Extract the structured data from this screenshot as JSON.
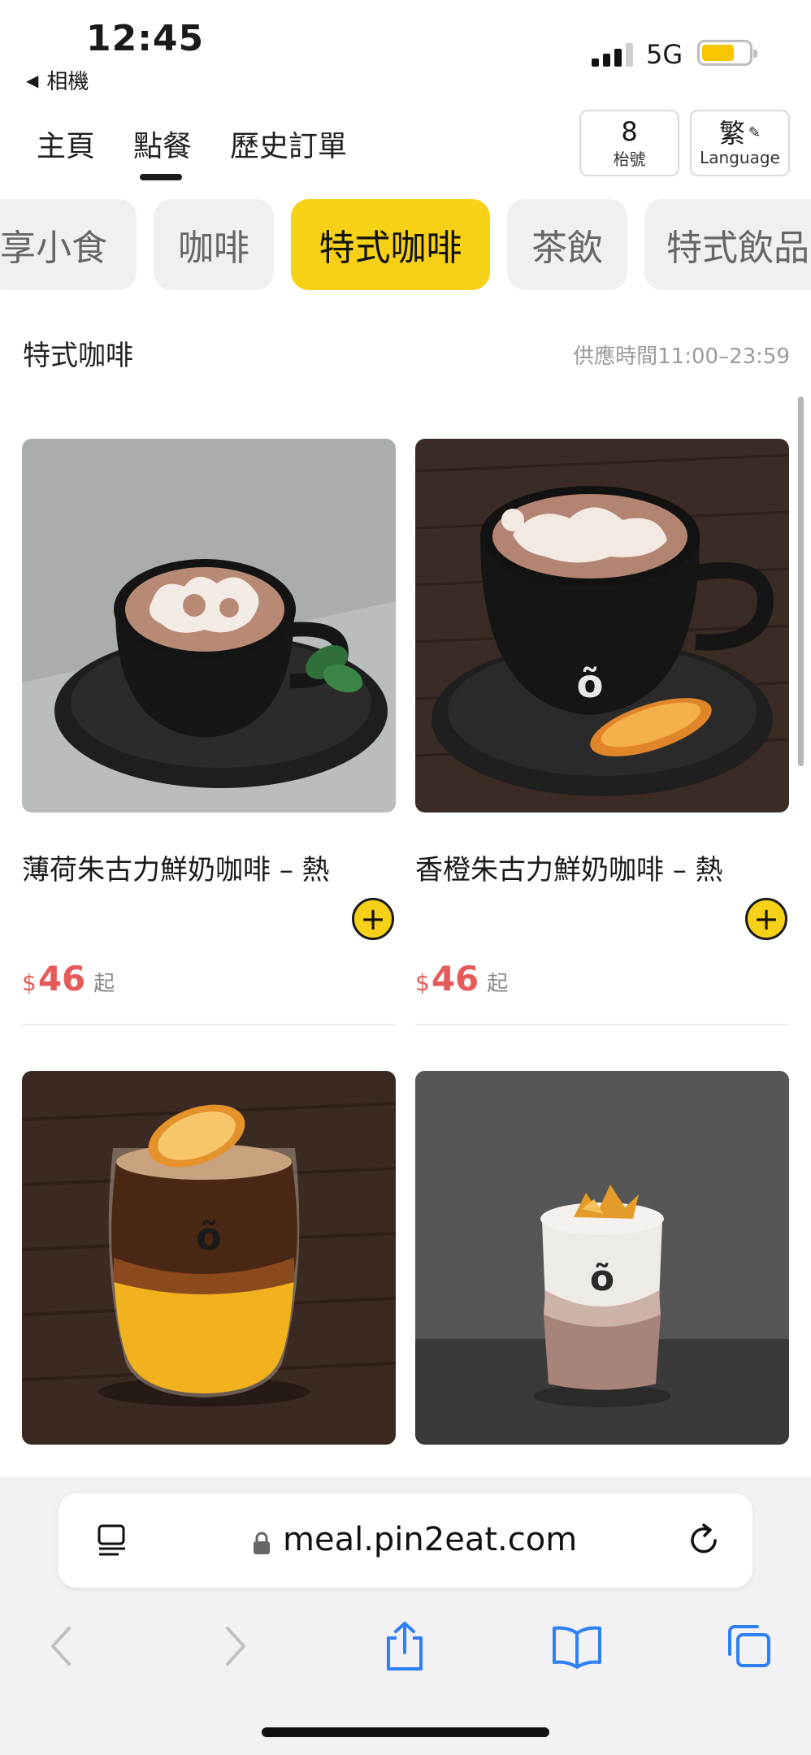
{
  "status_bar": {
    "time": "12:45",
    "back_app": "相機",
    "network": "5G",
    "battery_level": 0.7
  },
  "nav": {
    "tabs": [
      {
        "label": "主頁",
        "active": false
      },
      {
        "label": "點餐",
        "active": true
      },
      {
        "label": "歷史訂單",
        "active": false
      }
    ],
    "table_number": "8",
    "table_label": "枱號",
    "language_current": "繁",
    "language_label": "Language"
  },
  "categories": [
    {
      "label": "享小食",
      "active": false
    },
    {
      "label": "咖啡",
      "active": false
    },
    {
      "label": "特式咖啡",
      "active": true
    },
    {
      "label": "茶飲",
      "active": false
    },
    {
      "label": "特式飲品",
      "active": false
    }
  ],
  "section": {
    "title": "特式咖啡",
    "serve_time": "供應時間11:00–23:59"
  },
  "products": [
    {
      "name": "薄荷朱古力鮮奶咖啡 – 熱",
      "currency": "$",
      "price": "46",
      "suffix": "起",
      "image": "mint-chocolate-latte-photo"
    },
    {
      "name": "香橙朱古力鮮奶咖啡 – 熱",
      "currency": "$",
      "price": "46",
      "suffix": "起",
      "image": "orange-chocolate-latte-photo"
    },
    {
      "name": "",
      "image": "orange-iced-coffee-photo"
    },
    {
      "name": "",
      "image": "iced-latte-crumble-photo"
    }
  ],
  "browser": {
    "url": "meal.pin2eat.com"
  },
  "colors": {
    "accent_yellow": "#f7d117",
    "price_red": "#e75a5a",
    "chip_gray": "#f0f0f0"
  }
}
